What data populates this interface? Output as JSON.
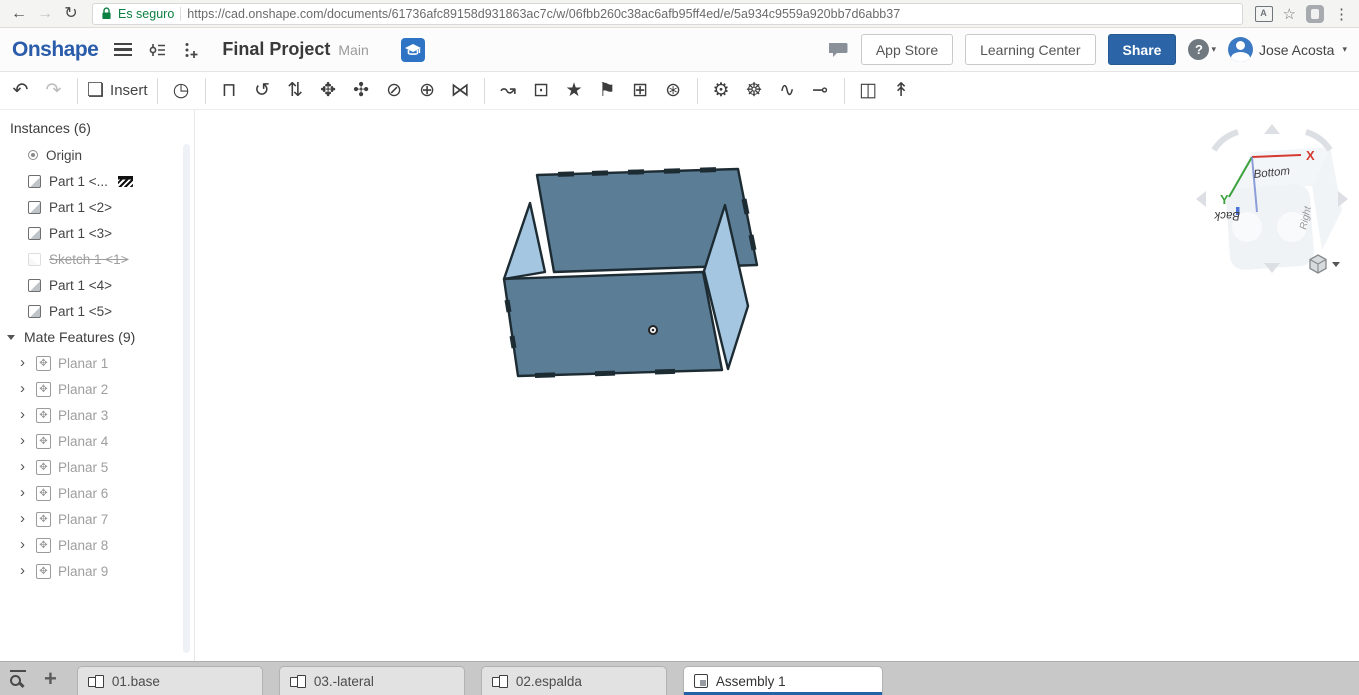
{
  "browser": {
    "security_label": "Es seguro",
    "url": "https://cad.onshape.com/documents/61736afc89158d931863ac7c/w/06fbb260c38ac6afb95ff4ed/e/5a934c9559a920bb7d6abb37"
  },
  "header": {
    "logo": "Onshape",
    "document_title": "Final Project",
    "workspace_name": "Main",
    "app_store": "App Store",
    "learning_center": "Learning Center",
    "share": "Share",
    "help": "?",
    "user_name": "Jose Acosta"
  },
  "toolbar": {
    "icons": [
      {
        "name": "undo-button",
        "glyph": "↶",
        "state": ""
      },
      {
        "name": "redo-button",
        "glyph": "↷",
        "state": "disabled"
      },
      {
        "name": "separator"
      },
      {
        "name": "insert-button",
        "glyph": "❏",
        "label": "Insert",
        "state": ""
      },
      {
        "name": "separator"
      },
      {
        "name": "named-views-button",
        "glyph": "◷",
        "state": ""
      },
      {
        "name": "separator"
      },
      {
        "name": "fastened-mate-button",
        "glyph": "⊓",
        "state": ""
      },
      {
        "name": "revolute-mate-button",
        "glyph": "↺",
        "state": ""
      },
      {
        "name": "slider-mate-button",
        "glyph": "⇅",
        "state": ""
      },
      {
        "name": "planar-mate-button",
        "glyph": "✥",
        "state": ""
      },
      {
        "name": "ball-mate-button",
        "glyph": "✣",
        "state": ""
      },
      {
        "name": "pin-slot-mate-button",
        "glyph": "⊘",
        "state": ""
      },
      {
        "name": "cylindrical-mate-button",
        "glyph": "⊕",
        "state": ""
      },
      {
        "name": "tangent-mate-button",
        "glyph": "⋈",
        "state": ""
      },
      {
        "name": "separator"
      },
      {
        "name": "snap-mode-button",
        "glyph": "↝",
        "state": ""
      },
      {
        "name": "select-region-button",
        "glyph": "⊡",
        "state": ""
      },
      {
        "name": "mate-connector-button",
        "glyph": "★",
        "state": ""
      },
      {
        "name": "named-position-button",
        "glyph": "⚑",
        "state": ""
      },
      {
        "name": "pattern-button",
        "glyph": "⊞",
        "state": ""
      },
      {
        "name": "group-button",
        "glyph": "⊛",
        "state": ""
      },
      {
        "name": "separator"
      },
      {
        "name": "gear-relation-button",
        "glyph": "⚙",
        "state": ""
      },
      {
        "name": "rack-relation-button",
        "glyph": "☸",
        "state": ""
      },
      {
        "name": "screw-relation-button",
        "glyph": "∿",
        "state": ""
      },
      {
        "name": "belt-relation-button",
        "glyph": "⊸",
        "state": ""
      },
      {
        "name": "separator"
      },
      {
        "name": "section-view-button",
        "glyph": "◫",
        "state": ""
      },
      {
        "name": "exploded-view-button",
        "glyph": "↟",
        "state": ""
      }
    ]
  },
  "instances_panel": {
    "title": "Instances (6)",
    "items": [
      {
        "label": "Origin",
        "icon": "origin-icon",
        "state": ""
      },
      {
        "label": "Part 1 <...",
        "icon": "part-icon",
        "state": "fixed"
      },
      {
        "label": "Part 1 <2>",
        "icon": "part-icon",
        "state": ""
      },
      {
        "label": "Part 1 <3>",
        "icon": "part-icon",
        "state": ""
      },
      {
        "label": "Sketch 1 <1>",
        "icon": "sketch-icon",
        "state": "suppressed"
      },
      {
        "label": "Part 1 <4>",
        "icon": "part-icon",
        "state": ""
      },
      {
        "label": "Part 1 <5>",
        "icon": "part-icon",
        "state": ""
      }
    ],
    "mate_features_title": "Mate Features (9)",
    "mate_items": [
      "Planar 1",
      "Planar 2",
      "Planar 3",
      "Planar 4",
      "Planar 5",
      "Planar 6",
      "Planar 7",
      "Planar 8",
      "Planar 9"
    ]
  },
  "viewport": {
    "view_cube": {
      "bottom_label": "Bottom",
      "back_label": "Back",
      "right_label": "Right",
      "x_axis": "X",
      "y_axis": "Y",
      "x_color": "#d43a2f",
      "y_color": "#3da23d",
      "z_color": "#7b8fd4"
    },
    "model": {
      "dark_panel": "#5b7d96",
      "light_panel": "#a4c6e1",
      "edge_color": "#1d2b33"
    }
  },
  "tabbar": {
    "tabs": [
      {
        "label": "01.base",
        "icon": "partstudio-icon",
        "state": ""
      },
      {
        "label": "03.-lateral",
        "icon": "partstudio-icon",
        "state": ""
      },
      {
        "label": "02.espalda",
        "icon": "partstudio-icon",
        "state": ""
      },
      {
        "label": "Assembly 1",
        "icon": "assembly-icon",
        "state": "active"
      }
    ]
  }
}
